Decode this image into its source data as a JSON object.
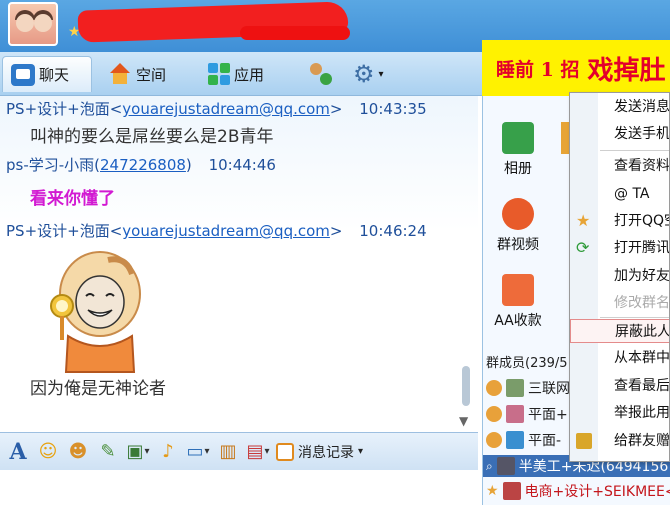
{
  "nav": {
    "tabs": [
      {
        "label": "聊天"
      },
      {
        "label": "空间"
      },
      {
        "label": "应用"
      }
    ]
  },
  "promo": {
    "text_a": "睡前 1 招",
    "text_b": "戏掉肚"
  },
  "messages": [
    {
      "sender": "PS+设计+泡面<",
      "email": "youarejustadream@qq.com",
      "tail": ">",
      "time": "10:43:35",
      "body": "叫神的要么是屌丝要么是2B青年"
    },
    {
      "sender": "ps-学习-小雨(",
      "email": "247226808",
      "tail": ")",
      "time": "10:44:46",
      "body": "看来你懂了"
    },
    {
      "sender": "PS+设计+泡面<",
      "email": "youarejustadream@qq.com",
      "tail": ">",
      "time": "10:46:24",
      "body": "因为俺是无神论者"
    }
  ],
  "toolbar": {
    "history_label": "消息记录"
  },
  "apps": [
    {
      "label": "相册"
    },
    {
      "label": "群视频"
    },
    {
      "label": "AA收款"
    }
  ],
  "members": {
    "header": "群成员(239/5",
    "rows": [
      {
        "name": "三联网"
      },
      {
        "name": "平面+"
      },
      {
        "name": "平面-"
      },
      {
        "name": "半美工+未迟(6494156"
      },
      {
        "name": "电商+设计+SEIKMEE<"
      }
    ]
  },
  "context_menu": {
    "items": [
      {
        "label": "发送消息"
      },
      {
        "label": "发送手机"
      },
      {
        "label": "查看资料"
      },
      {
        "label": "@ TA"
      },
      {
        "label": "打开QQ空"
      },
      {
        "label": "打开腾讯"
      },
      {
        "label": "加为好友"
      },
      {
        "label": "修改群名"
      },
      {
        "label": "屏蔽此人"
      },
      {
        "label": "从本群中"
      },
      {
        "label": "查看最后"
      },
      {
        "label": "举报此用"
      },
      {
        "label": "给群友赠"
      }
    ]
  },
  "colors": {
    "redaction": "#f21f1f",
    "promo_bg": "#fff200",
    "accent": "#3f8fd6",
    "highlight_msg": "#d21ad2"
  }
}
